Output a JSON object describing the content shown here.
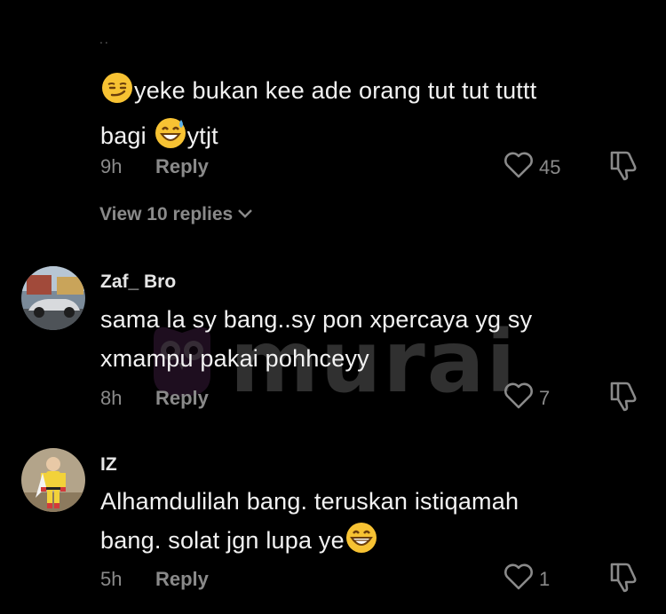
{
  "colors": {
    "background": "#000000",
    "text_primary": "#f2f2f2",
    "text_secondary": "#8a8a8a",
    "watermark_purple": "#8a3f8f"
  },
  "top_fragment": "..",
  "comments": [
    {
      "username": "",
      "text_line1": "yeke bukan kee ade orang tut tut tuttt",
      "text_line2_a": "bagi ",
      "text_line2_b": "ytjt",
      "emojis": [
        "smirking-face-emoji",
        "grinning-sweat-emoji"
      ],
      "time": "9h",
      "reply_label": "Reply",
      "likes": "45",
      "view_replies": "View 10 replies"
    },
    {
      "username": "Zaf_ Bro",
      "text_line1": "sama la sy bang..sy pon xpercaya yg sy",
      "text_line2_a": "xmampu pakai pohhceyy",
      "avatar": "car-photo-avatar",
      "time": "8h",
      "reply_label": "Reply",
      "likes": "7"
    },
    {
      "username": "IZ",
      "text_line1": "Alhamdulilah bang. teruskan istiqamah",
      "text_line2_a": "bang. solat jgn lupa ye",
      "avatar": "superhero-costume-avatar",
      "emojis": [
        "grinning-face-emoji"
      ],
      "time": "5h",
      "reply_label": "Reply",
      "likes": "1"
    }
  ],
  "watermark": {
    "text": "murai",
    "icon": "owl-logo-icon"
  }
}
